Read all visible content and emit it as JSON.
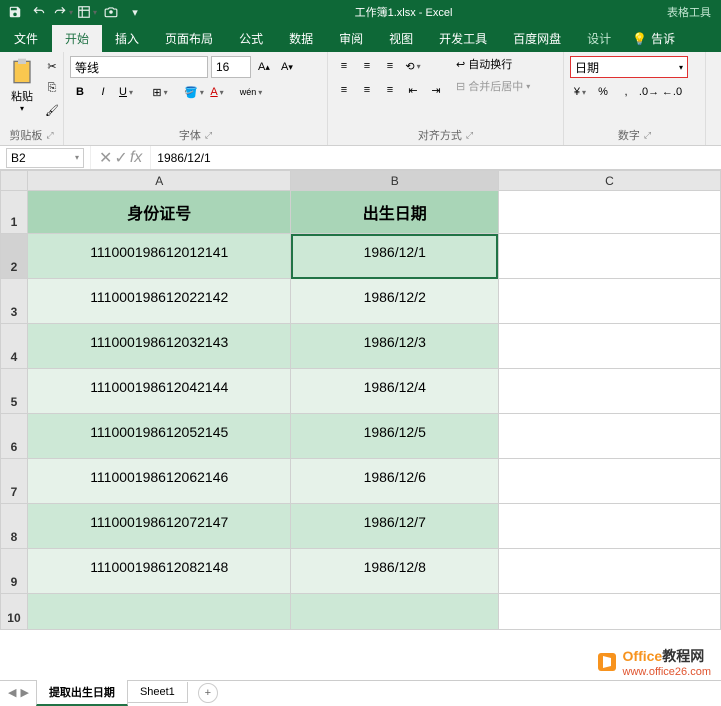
{
  "title": "工作簿1.xlsx - Excel",
  "tableTools": "表格工具",
  "tabs": {
    "file": "文件",
    "home": "开始",
    "insert": "插入",
    "layout": "页面布局",
    "formulas": "公式",
    "data": "数据",
    "review": "审阅",
    "view": "视图",
    "dev": "开发工具",
    "baidu": "百度网盘",
    "design": "设计",
    "tellme": "告诉"
  },
  "ribbon": {
    "paste": "粘贴",
    "clipboard": "剪贴板",
    "fontName": "等线",
    "fontSize": "16",
    "fontGroup": "字体",
    "wrap": "自动换行",
    "merge": "合并后居中",
    "alignGroup": "对齐方式",
    "numFmt": "日期",
    "numGroup": "数字"
  },
  "nameBox": "B2",
  "formula": "1986/12/1",
  "cols": {
    "A": "A",
    "B": "B",
    "C": "C"
  },
  "headers": {
    "id": "身份证号",
    "dob": "出生日期"
  },
  "rows": [
    {
      "n": "1"
    },
    {
      "n": "2",
      "id": "111000198612012141",
      "dob": "1986/12/1"
    },
    {
      "n": "3",
      "id": "111000198612022142",
      "dob": "1986/12/2"
    },
    {
      "n": "4",
      "id": "111000198612032143",
      "dob": "1986/12/3"
    },
    {
      "n": "5",
      "id": "111000198612042144",
      "dob": "1986/12/4"
    },
    {
      "n": "6",
      "id": "111000198612052145",
      "dob": "1986/12/5"
    },
    {
      "n": "7",
      "id": "111000198612062146",
      "dob": "1986/12/6"
    },
    {
      "n": "8",
      "id": "111000198612072147",
      "dob": "1986/12/7"
    },
    {
      "n": "9",
      "id": "111000198612082148",
      "dob": "1986/12/8"
    },
    {
      "n": "10"
    }
  ],
  "sheets": {
    "s1": "提取出生日期",
    "s2": "Sheet1"
  },
  "watermark": {
    "brand1": "Office",
    "brand2": "教程网",
    "url": "www.office26.com"
  }
}
